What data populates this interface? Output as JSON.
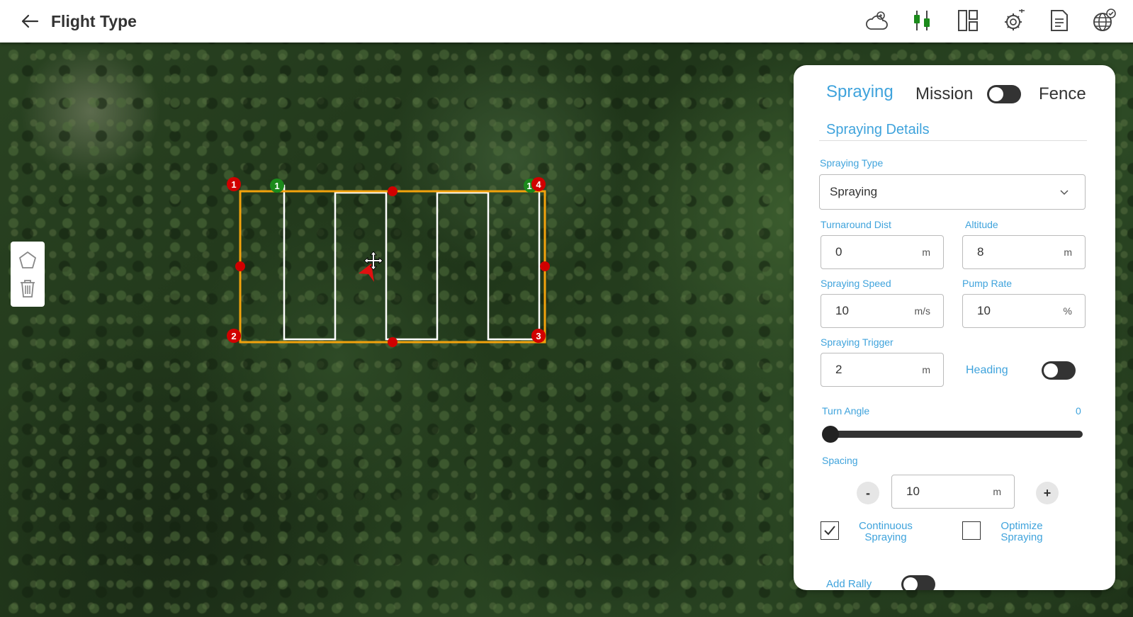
{
  "header": {
    "title": "Flight Type",
    "tools": [
      {
        "name": "weather-icon"
      },
      {
        "name": "sensor-connection-icon"
      },
      {
        "name": "layout-icon"
      },
      {
        "name": "drone-settings-icon"
      },
      {
        "name": "document-icon"
      },
      {
        "name": "globe-check-icon"
      }
    ]
  },
  "map": {
    "polygon_vertex_labels": [
      "1",
      "2",
      "3",
      "4"
    ],
    "start_label": "1",
    "end_label": "1",
    "colors": {
      "boundary": "#f2a20c",
      "vertex": "#d10000",
      "waypoint": "#1b8a1b",
      "path": "#ffffff"
    }
  },
  "panel": {
    "modes": {
      "spraying": "Spraying",
      "mission": "Mission",
      "fence": "Fence"
    },
    "section_title": "Spraying Details",
    "spraying_type": {
      "label": "Spraying Type",
      "value": "Spraying"
    },
    "turnaround_dist": {
      "label": "Turnaround Dist",
      "value": "0",
      "unit": "m"
    },
    "altitude": {
      "label": "Altitude",
      "value": "8",
      "unit": "m"
    },
    "spraying_speed": {
      "label": "Spraying Speed",
      "value": "10",
      "unit": "m/s"
    },
    "pump_rate": {
      "label": "Pump Rate",
      "value": "10",
      "unit": "%"
    },
    "spraying_trigger": {
      "label": "Spraying Trigger",
      "value": "2",
      "unit": "m"
    },
    "heading": {
      "label": "Heading",
      "enabled": false
    },
    "turn_angle": {
      "label": "Turn Angle",
      "value": "0"
    },
    "spacing": {
      "label": "Spacing",
      "value": "10",
      "unit": "m",
      "minus": "-",
      "plus": "+"
    },
    "continuous_spraying": {
      "label": "Continuous\nSpraying",
      "checked": true
    },
    "optimize_spraying": {
      "label": "Optimize\nSpraying",
      "checked": false
    },
    "add_rally": {
      "label": "Add Rally",
      "enabled": false
    },
    "accent_color": "#3fa3dc"
  }
}
